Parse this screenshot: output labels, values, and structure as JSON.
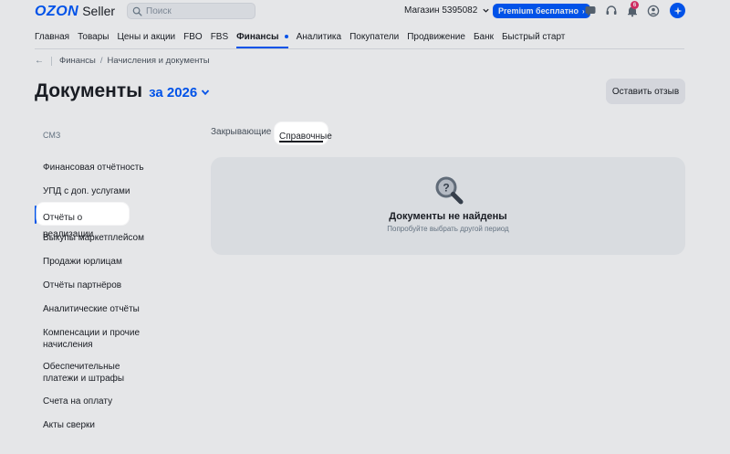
{
  "header": {
    "logo_brand": "OZON",
    "logo_product": "Seller",
    "search_placeholder": "Поиск",
    "store_label": "Магазин 5395082",
    "premium_label": "Premium бесплатно",
    "notifications_count": "6"
  },
  "nav": {
    "items": [
      {
        "label": "Главная"
      },
      {
        "label": "Товары"
      },
      {
        "label": "Цены и акции"
      },
      {
        "label": "FBO"
      },
      {
        "label": "FBS"
      },
      {
        "label": "Финансы"
      },
      {
        "label": "Аналитика"
      },
      {
        "label": "Покупатели"
      },
      {
        "label": "Продвижение"
      },
      {
        "label": "Банк"
      },
      {
        "label": "Быстрый старт"
      }
    ],
    "active": "Финансы"
  },
  "breadcrumb": {
    "back": "←",
    "items": [
      "Финансы",
      "Начисления и документы"
    ]
  },
  "page": {
    "title": "Документы",
    "year_selector": "за 2026",
    "feedback_button": "Оставить отзыв"
  },
  "sidebar": {
    "items": [
      {
        "label": "СМЗ"
      },
      {
        "label": "Финансовая отчётность"
      },
      {
        "label": "УПД с доп. услугами"
      },
      {
        "label": "Отчёты о реализации"
      },
      {
        "label": "Выкупы маркетплейсом"
      },
      {
        "label": "Продажи юрлицам"
      },
      {
        "label": "Отчёты партнёров"
      },
      {
        "label": "Аналитические отчёты"
      },
      {
        "label": "Компенсации и прочие начисления"
      },
      {
        "label": "Обеспечительные платежи и штрафы"
      },
      {
        "label": "Счета на оплату"
      },
      {
        "label": "Акты сверки"
      }
    ],
    "selected": "Отчёты о реализации"
  },
  "tabs": {
    "items": [
      {
        "label": "Закрывающие"
      },
      {
        "label": "Справочные"
      }
    ],
    "active": "Справочные"
  },
  "empty_state": {
    "title": "Документы не найдены",
    "subtitle": "Попробуйте выбрать другой период"
  },
  "colors": {
    "accent": "#005bff",
    "badge": "#e8306a"
  }
}
